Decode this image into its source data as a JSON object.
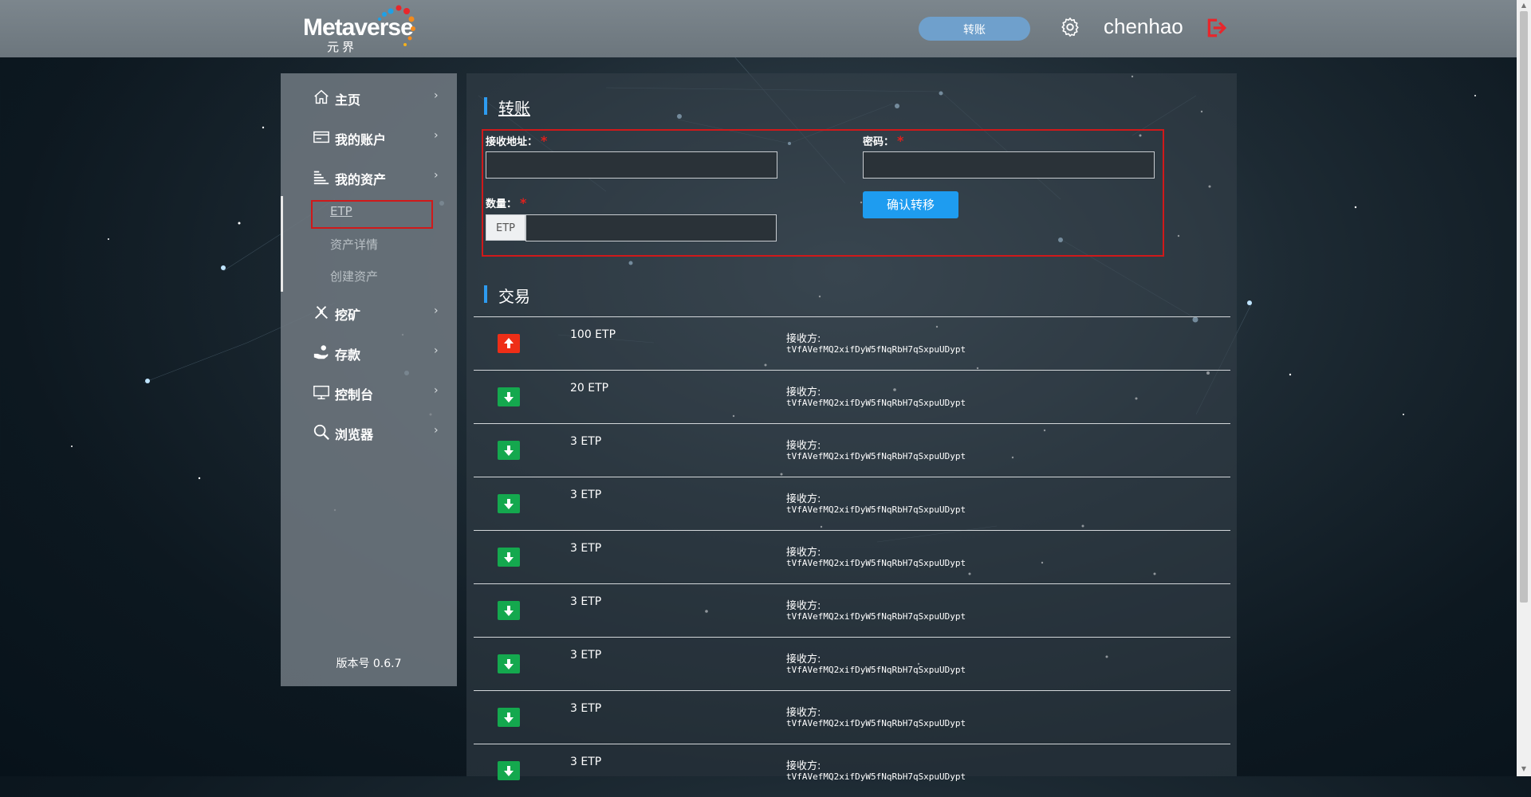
{
  "header": {
    "logo_text": "Metaverse",
    "logo_sub": "元界",
    "transfer_button": "转账",
    "username": "chenhao"
  },
  "sidebar": {
    "items": [
      {
        "label": "主页",
        "icon": "home-icon"
      },
      {
        "label": "我的账户",
        "icon": "account-card-icon"
      },
      {
        "label": "我的资产",
        "icon": "assets-stack-icon"
      },
      {
        "label": "挖矿",
        "icon": "mining-tools-icon"
      },
      {
        "label": "存款",
        "icon": "deposit-hand-icon"
      },
      {
        "label": "控制台",
        "icon": "monitor-icon"
      },
      {
        "label": "浏览器",
        "icon": "search-icon"
      }
    ],
    "sub_items": [
      "ETP",
      "资产详情",
      "创建资产"
    ],
    "version": "版本号 0.6.7"
  },
  "transfer_form": {
    "title": "转账",
    "address_label": "接收地址：",
    "password_label": "密码：",
    "amount_label": "数量：",
    "currency_addon": "ETP",
    "confirm_button": "确认转移",
    "required_mark": "*"
  },
  "transactions": {
    "title": "交易",
    "recipient_label": "接收方:",
    "rows": [
      {
        "direction": "out",
        "amount": "100 ETP",
        "address": "tVfAVefMQ2xifDyW5fNqRbH7qSxpuUDypt"
      },
      {
        "direction": "in",
        "amount": "20 ETP",
        "address": "tVfAVefMQ2xifDyW5fNqRbH7qSxpuUDypt"
      },
      {
        "direction": "in",
        "amount": "3 ETP",
        "address": "tVfAVefMQ2xifDyW5fNqRbH7qSxpuUDypt"
      },
      {
        "direction": "in",
        "amount": "3 ETP",
        "address": "tVfAVefMQ2xifDyW5fNqRbH7qSxpuUDypt"
      },
      {
        "direction": "in",
        "amount": "3 ETP",
        "address": "tVfAVefMQ2xifDyW5fNqRbH7qSxpuUDypt"
      },
      {
        "direction": "in",
        "amount": "3 ETP",
        "address": "tVfAVefMQ2xifDyW5fNqRbH7qSxpuUDypt"
      },
      {
        "direction": "in",
        "amount": "3 ETP",
        "address": "tVfAVefMQ2xifDyW5fNqRbH7qSxpuUDypt"
      },
      {
        "direction": "in",
        "amount": "3 ETP",
        "address": "tVfAVefMQ2xifDyW5fNqRbH7qSxpuUDypt"
      },
      {
        "direction": "in",
        "amount": "3 ETP",
        "address": "tVfAVefMQ2xifDyW5fNqRbH7qSxpuUDypt"
      }
    ]
  },
  "colors": {
    "accent_blue": "#1e9cf0",
    "outgoing_red": "#ee2e17",
    "incoming_green": "#14a84e",
    "highlight_red": "#d0191a"
  }
}
